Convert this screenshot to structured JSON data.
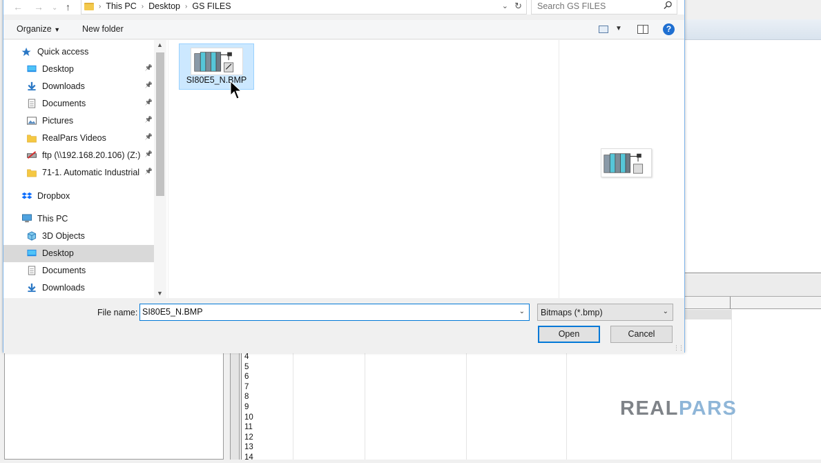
{
  "dialog": {
    "breadcrumbs": [
      "This PC",
      "Desktop",
      "GS FILES"
    ],
    "search_placeholder": "Search GS FILES",
    "toolbar": {
      "organize": "Organize",
      "new_folder": "New folder",
      "help": "?"
    },
    "nav": {
      "items": [
        {
          "label": "Quick access",
          "icon": "star-icon",
          "pinned": false
        },
        {
          "label": "Desktop",
          "icon": "desktop-icon",
          "pinned": true
        },
        {
          "label": "Downloads",
          "icon": "download-arrow-icon",
          "pinned": true
        },
        {
          "label": "Documents",
          "icon": "document-icon",
          "pinned": true
        },
        {
          "label": "Pictures",
          "icon": "pictures-icon",
          "pinned": true
        },
        {
          "label": "RealPars Videos",
          "icon": "folder-icon",
          "pinned": true
        },
        {
          "label": "ftp (\\\\192.168.20.106) (Z:)",
          "icon": "network-drive-icon",
          "pinned": true
        },
        {
          "label": "71-1. Automatic Industrial",
          "icon": "folder-icon",
          "pinned": true
        },
        {
          "label": "Dropbox",
          "icon": "dropbox-icon",
          "pinned": false
        },
        {
          "label": "This PC",
          "icon": "computer-icon",
          "pinned": false
        },
        {
          "label": "3D Objects",
          "icon": "cube-icon",
          "pinned": false
        },
        {
          "label": "Desktop",
          "icon": "desktop-icon",
          "pinned": false,
          "selected": true
        },
        {
          "label": "Documents",
          "icon": "document-icon",
          "pinned": false
        },
        {
          "label": "Downloads",
          "icon": "download-arrow-icon",
          "pinned": false
        }
      ]
    },
    "file": {
      "name": "SI80E5_N.BMP",
      "icon": "plc-rack-icon"
    },
    "bottom": {
      "file_name_label": "File name:",
      "file_name_value": "SI80E5_N.BMP",
      "filter": "Bitmaps (*.bmp)",
      "open": "Open",
      "cancel": "Cancel"
    }
  },
  "background": {
    "row_numbers": [
      "4",
      "5",
      "6",
      "7",
      "8",
      "9",
      "10",
      "11",
      "12",
      "13",
      "14"
    ],
    "logo_part1": "REAL",
    "logo_part2": "PARS"
  },
  "colors": {
    "accent": "#0078d7",
    "selection": "#cce8ff",
    "logo_gray": "#7f8388",
    "logo_blue": "#8fb6d8"
  }
}
